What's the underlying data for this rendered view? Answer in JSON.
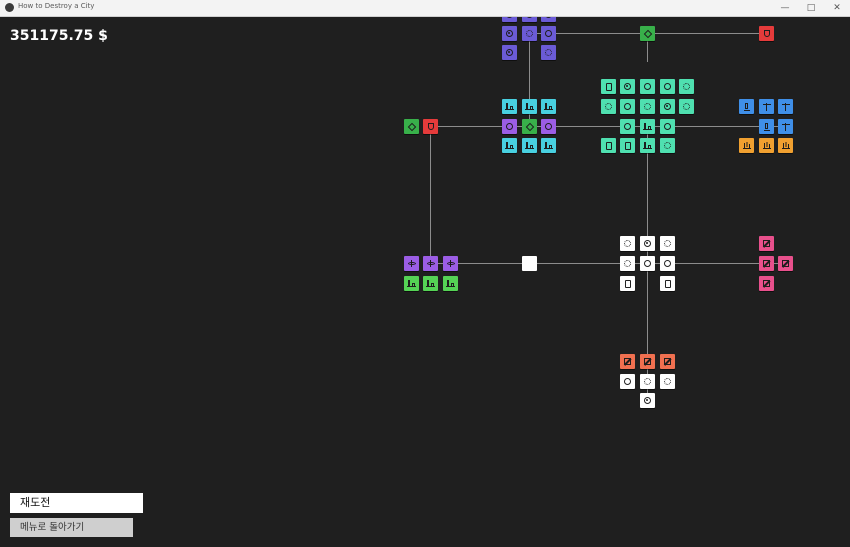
{
  "window": {
    "title": "How to Destroy a City",
    "minimize_glyph": "—",
    "maximize_glyph": "□",
    "close_glyph": "✕"
  },
  "hud": {
    "money": "351175.75 $"
  },
  "buttons": {
    "retry": "재도전",
    "back_to_menu": "메뉴로 돌아가기"
  },
  "colors": {
    "background": "#1f1f1f",
    "connector": "#8c8c8c",
    "indigo": "#6b5bd6",
    "purple": "#9b5de5",
    "mint": "#4fe0b0",
    "teal": "#48d0e0",
    "green": "#38b04a",
    "red": "#e53b3b",
    "blue": "#3f8fe8",
    "orange": "#f0a030",
    "lime": "#55d255",
    "coral": "#f07050",
    "pink": "#e8508c",
    "white": "#ffffff"
  }
}
